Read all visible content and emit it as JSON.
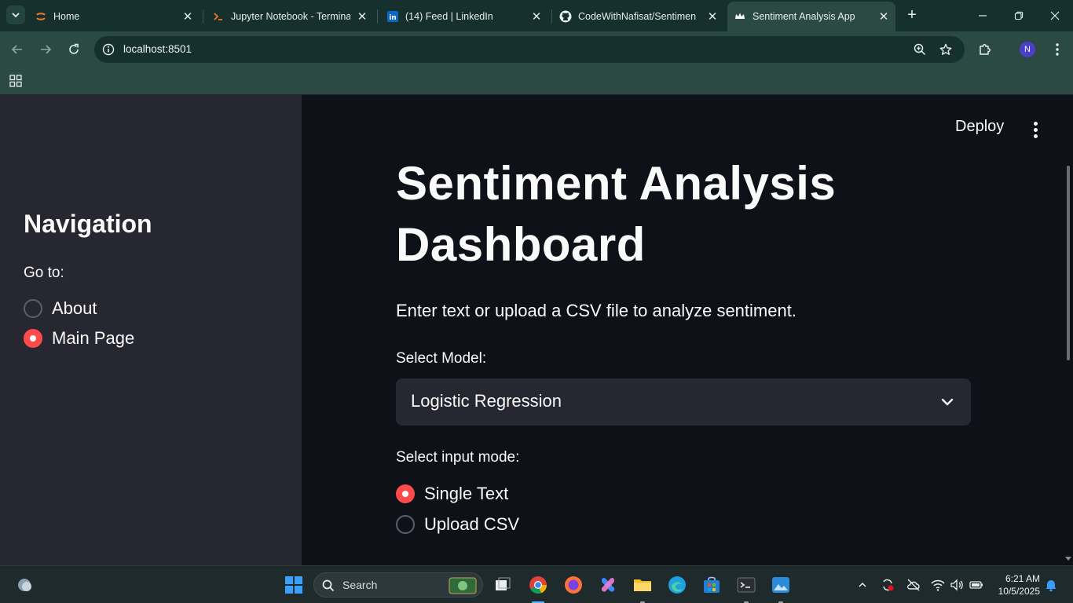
{
  "browser": {
    "tabs": [
      {
        "label": "Home",
        "icon": "jupyter-icon"
      },
      {
        "label": "Jupyter Notebook - Terminal",
        "icon": "terminal-icon"
      },
      {
        "label": "(14) Feed | LinkedIn",
        "icon": "linkedin-icon"
      },
      {
        "label": "CodeWithNafisat/Sentiment",
        "icon": "github-icon"
      },
      {
        "label": "Sentiment Analysis App",
        "icon": "streamlit-crown-icon",
        "active": true
      }
    ],
    "url": "localhost:8501",
    "profile_initial": "N",
    "colors": {
      "chrome": "#2c4a44",
      "tabstrip": "#15302d"
    }
  },
  "sidebar": {
    "title": "Navigation",
    "goto_label": "Go to:",
    "options": [
      {
        "label": "About",
        "selected": false
      },
      {
        "label": "Main Page",
        "selected": true
      }
    ]
  },
  "header": {
    "deploy_label": "Deploy"
  },
  "main": {
    "title": "Sentiment Analysis Dashboard",
    "subtitle": "Enter text or upload a CSV file to analyze sentiment.",
    "model_label": "Select Model:",
    "model_value": "Logistic Regression",
    "mode_label": "Select input mode:",
    "modes": [
      {
        "label": "Single Text",
        "selected": true
      },
      {
        "label": "Upload CSV",
        "selected": false
      }
    ],
    "accent_color": "#ff4b4b"
  },
  "taskbar": {
    "search_placeholder": "Search",
    "time": "6:21 AM",
    "date": "10/5/2025"
  }
}
